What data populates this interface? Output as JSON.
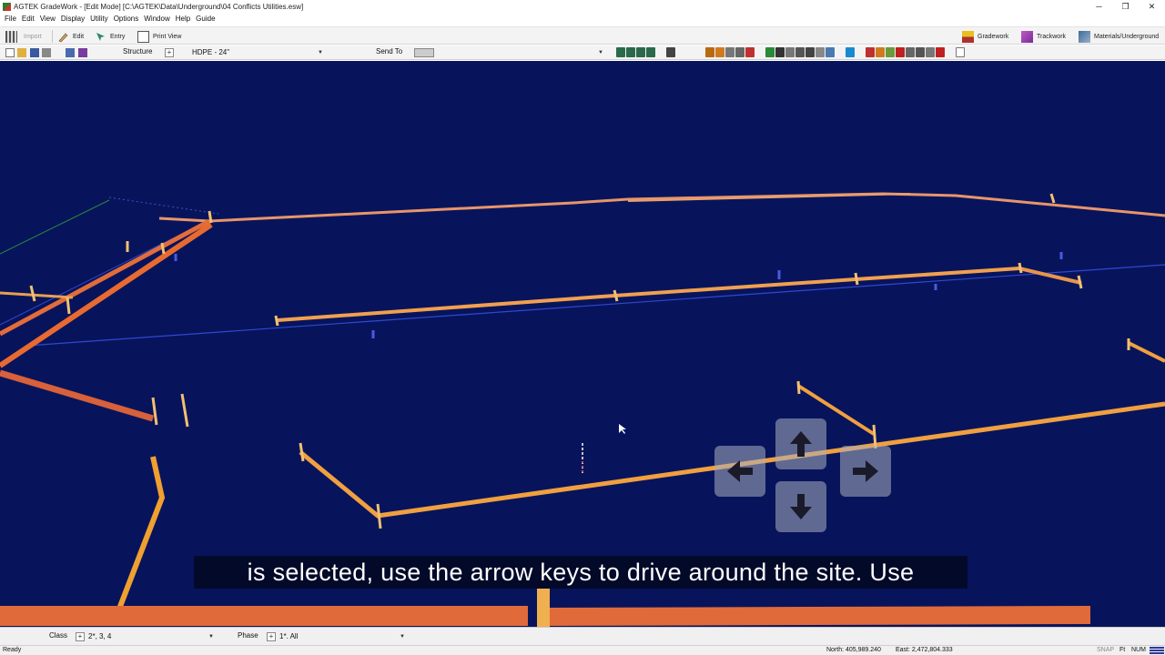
{
  "window": {
    "title": "AGTEK GradeWork - [Edit Mode]  [C:\\AGTEK\\Data\\Underground\\04 Conflicts Utilities.esw]",
    "minimize": "─",
    "restore": "❐",
    "close": "✕"
  },
  "menu": [
    "File",
    "Edit",
    "View",
    "Display",
    "Utility",
    "Options",
    "Window",
    "Help",
    "Guide"
  ],
  "toolbar": {
    "import_label": "Import",
    "edit_label": "Edit",
    "entry_label": "Entry",
    "print_view_label": "Print View",
    "gradework_label": "Gradework",
    "trackwork_label": "Trackwork",
    "materials_label": "Materials/Underground"
  },
  "toolbar2": {
    "structure_label": "Structure",
    "structure_plus": "+",
    "structure_value": "HDPE - 24\"",
    "send_to_label": "Send To",
    "send_to_value": ""
  },
  "viewport": {
    "background": "#07145c",
    "pipe_color": "#e89a3a",
    "caption": "is selected, use the arrow keys to drive around the site.  Use",
    "arrow_keys": [
      "up",
      "left",
      "right",
      "down"
    ]
  },
  "bottom": {
    "class_label": "Class",
    "class_plus": "+",
    "class_value": "2*, 3, 4",
    "phase_label": "Phase",
    "phase_plus": "+",
    "phase_value": "1*. All"
  },
  "status": {
    "ready": "Ready",
    "north": "North: 405,989.240",
    "east": "East: 2,472,804.333",
    "snap": "SNAP",
    "ft": "Ft",
    "num": "NUM"
  }
}
